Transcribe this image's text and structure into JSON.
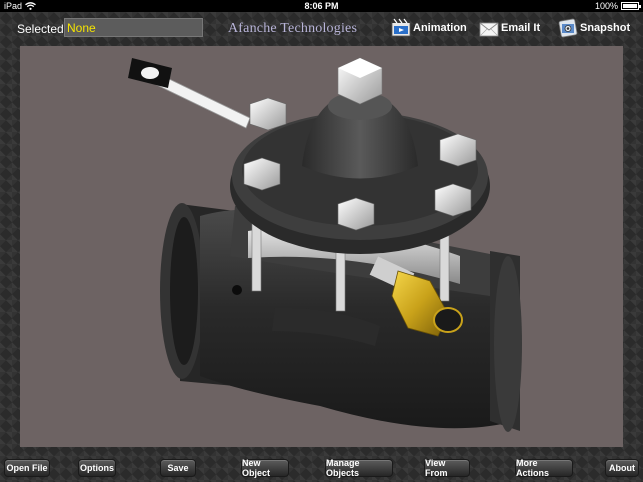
{
  "status": {
    "device": "iPad",
    "time": "8:06 PM",
    "battery": "100%"
  },
  "top": {
    "selected_label": "Selected",
    "selected_value": "None",
    "brand": "Afanche Technologies",
    "animation_label": "Animation",
    "email_label": "Email It",
    "snapshot_label": "Snapshot"
  },
  "bottom": {
    "open_file": "Open File",
    "options": "Options",
    "save": "Save",
    "new_object": "New Object",
    "manage_objects": "Manage Objects",
    "view_from": "View From",
    "more_actions": "More Actions",
    "about": "About"
  },
  "colors": {
    "selected_value_text": "#f5e400",
    "viewport_bg": "#6d6363",
    "brand_text": "#b8b4d8"
  },
  "icons": [
    "wifi-icon",
    "battery-icon",
    "film-icon",
    "envelope-icon",
    "camera-icon"
  ]
}
